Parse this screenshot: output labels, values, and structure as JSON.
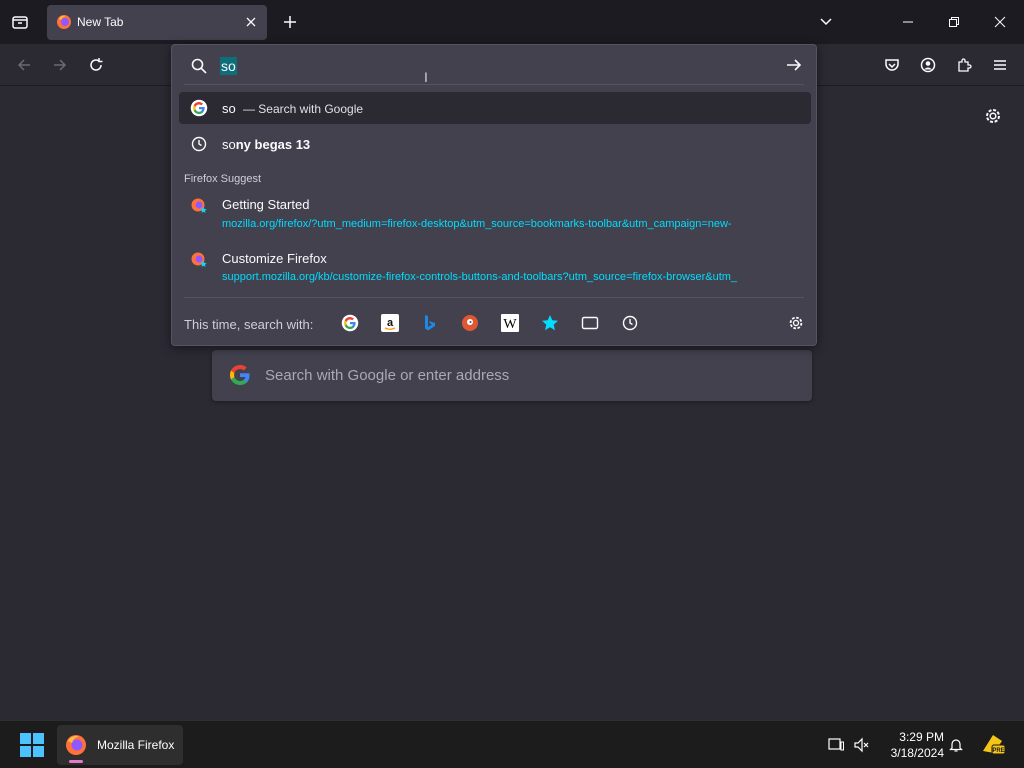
{
  "tab": {
    "title": "New Tab"
  },
  "urlbar": {
    "typed_text": "so",
    "rows": [
      {
        "type": "search",
        "text": "so",
        "action": "— Search with Google"
      },
      {
        "type": "history",
        "prefix": "so",
        "bold": "ny begas 13"
      }
    ],
    "group_label": "Firefox Suggest",
    "suggestions": [
      {
        "title": "Getting Started",
        "url": "mozilla.org/firefox/?utm_medium=firefox-desktop&utm_source=bookmarks-toolbar&utm_campaign=new-"
      },
      {
        "title": "Customize Firefox",
        "url": "support.mozilla.org/kb/customize-firefox-controls-buttons-and-toolbars?utm_source=firefox-browser&utm_"
      }
    ],
    "oneoff_label": "This time, search with:",
    "engines": [
      "google-icon",
      "amazon-icon",
      "bing-icon",
      "duckduckgo-icon",
      "wikipedia-icon",
      "bookmarks-icon",
      "tabs-icon",
      "history-icon"
    ]
  },
  "page": {
    "search_placeholder": "Search with Google or enter address"
  },
  "taskbar": {
    "app_label": "Mozilla Firefox",
    "time": "3:29 PM",
    "date": "3/18/2024"
  },
  "colors": {
    "accent": "#00ddff",
    "selection": "#0e6e7a",
    "background": "#2b2a33",
    "panel": "#42414d"
  }
}
